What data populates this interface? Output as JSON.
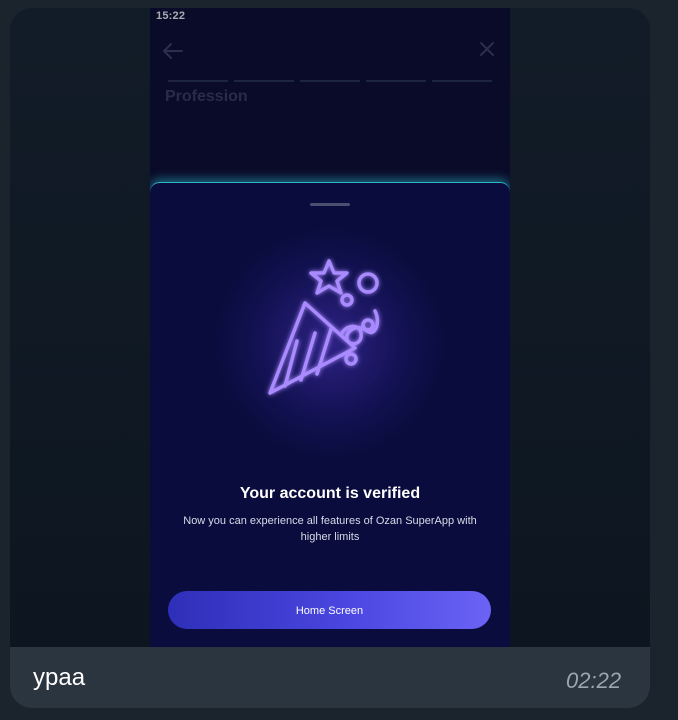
{
  "phone": {
    "status_time": "15:22",
    "profession_label": "Profession"
  },
  "sheet": {
    "illustration_icon": "party-popper-icon",
    "title": "Your account is verified",
    "subtitle": "Now you can experience all features of Ozan SuperApp with higher limits",
    "button_label": "Home Screen"
  },
  "message": {
    "caption": "ypaa",
    "timestamp": "02:22"
  },
  "colors": {
    "accent": "#7b4dff",
    "sheet_bg": "#090c3c",
    "button_gradient_start": "#2e2fb8",
    "button_gradient_end": "#6b63f5",
    "bubble_bg": "#2a3540"
  }
}
